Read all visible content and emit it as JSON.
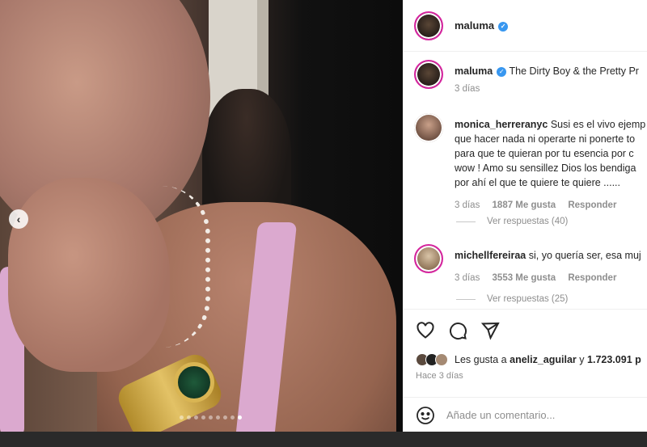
{
  "post": {
    "username": "maluma",
    "caption": "The Dirty Boy & the Pretty Pr",
    "caption_time": "3 días"
  },
  "comments": [
    {
      "username": "monica_herreranyc",
      "lines": [
        "Susi es el vivo ejemp",
        "que hacer nada ni operarte ni ponerte to",
        "para que te quieran por tu esencia por c",
        "wow ! Amo su sensillez Dios los bendiga",
        "por ahí el que te quiere te quiere ......"
      ],
      "time": "3 días",
      "likes": "1887 Me gusta",
      "reply": "Responder",
      "view_replies": "Ver respuestas (40)"
    },
    {
      "username": "michellfereiraa",
      "text": "si, yo quería ser, esa muj",
      "time": "3 días",
      "likes": "3553 Me gusta",
      "reply": "Responder",
      "view_replies": "Ver respuestas (25)"
    }
  ],
  "likes": {
    "prefix": "Les gusta a",
    "user": "aneliz_aguilar",
    "middle": "y",
    "count": "1.723.091 p"
  },
  "time_ago": "Hace 3 días",
  "add_comment": {
    "placeholder": "Añade un comentario..."
  },
  "carousel": {
    "total": 9,
    "active_index": 8
  },
  "colors": {
    "verified": "#3897f0",
    "ring": "#d6249f"
  }
}
